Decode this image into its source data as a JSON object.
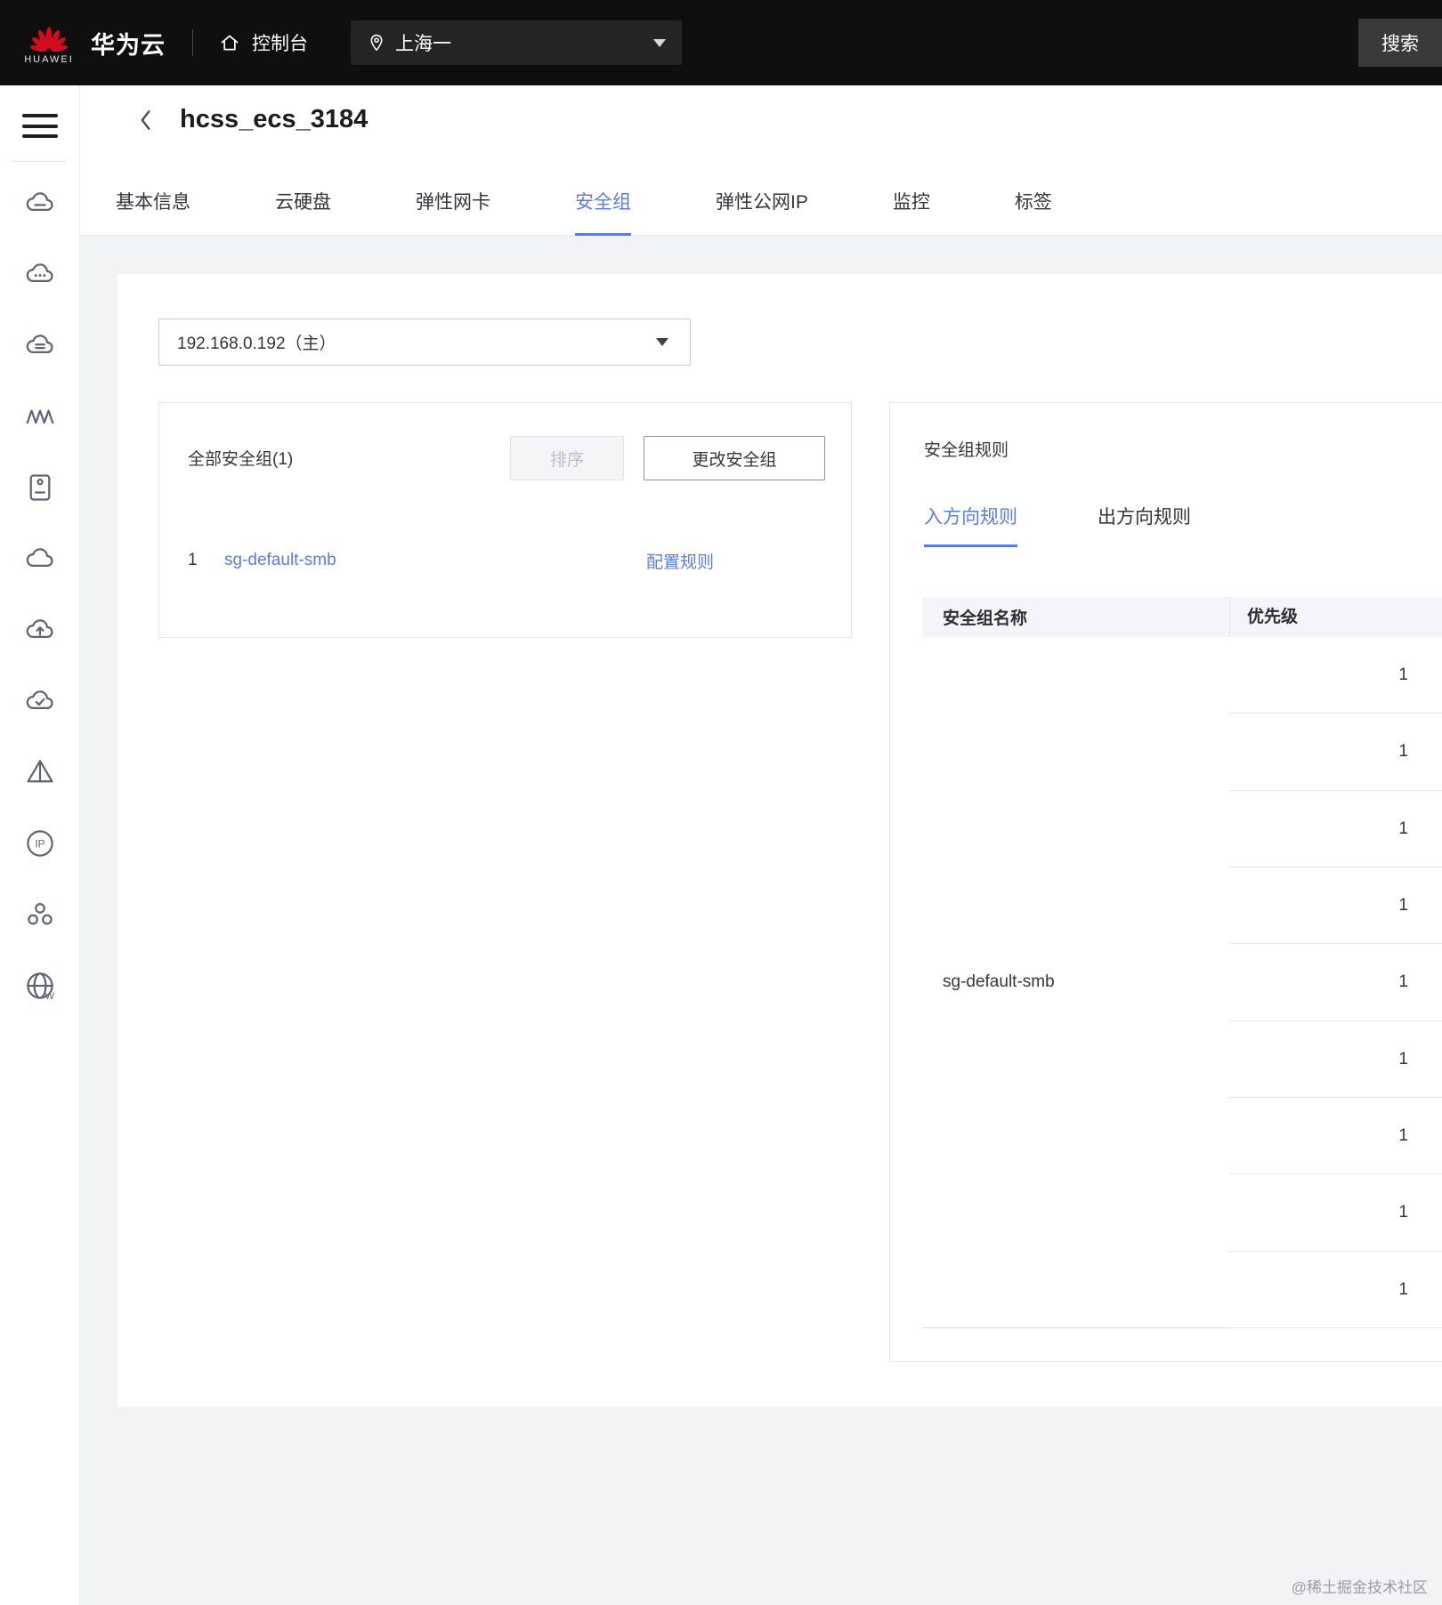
{
  "header": {
    "brand": "华为云",
    "logo_label": "HUAWEI",
    "console_label": "控制台",
    "region": "上海一",
    "search_label": "搜索"
  },
  "sidebar": {
    "menu_icon": "hamburger-menu-icon",
    "icons": [
      "cloud-server-icon",
      "cloud-dots-icon",
      "cloud-list-icon",
      "auto-scaling-icon",
      "server-box-icon",
      "cloud-icon",
      "cloud-upload-icon",
      "cloud-check-icon",
      "prism-icon",
      "ip-icon",
      "cluster-icon",
      "globe-icon"
    ]
  },
  "page": {
    "title": "hcss_ecs_3184",
    "tabs": [
      {
        "label": "基本信息",
        "active": false
      },
      {
        "label": "云硬盘",
        "active": false
      },
      {
        "label": "弹性网卡",
        "active": false
      },
      {
        "label": "安全组",
        "active": true
      },
      {
        "label": "弹性公网IP",
        "active": false
      },
      {
        "label": "监控",
        "active": false
      },
      {
        "label": "标签",
        "active": false
      }
    ]
  },
  "content": {
    "nic_selector": {
      "value": "192.168.0.192（主）"
    },
    "groups_panel": {
      "title": "全部安全组(1)",
      "sort_button": "排序",
      "change_button": "更改安全组",
      "rows": [
        {
          "index": "1",
          "name": "sg-default-smb",
          "action": "配置规则"
        }
      ]
    },
    "rules_panel": {
      "title": "安全组规则",
      "tabs": [
        {
          "label": "入方向规则",
          "active": true
        },
        {
          "label": "出方向规则",
          "active": false
        }
      ],
      "table": {
        "columns": [
          "安全组名称",
          "优先级"
        ],
        "group_name": "sg-default-smb",
        "priority_values": [
          "1",
          "1",
          "1",
          "1",
          "1",
          "1",
          "1",
          "1",
          "1"
        ]
      }
    }
  },
  "footer": {
    "watermark": "@稀土掘金技术社区"
  },
  "colors": {
    "accent": "#5e7ce0",
    "brand_red": "#d40b1e",
    "header_bg": "#0f0f0f"
  }
}
